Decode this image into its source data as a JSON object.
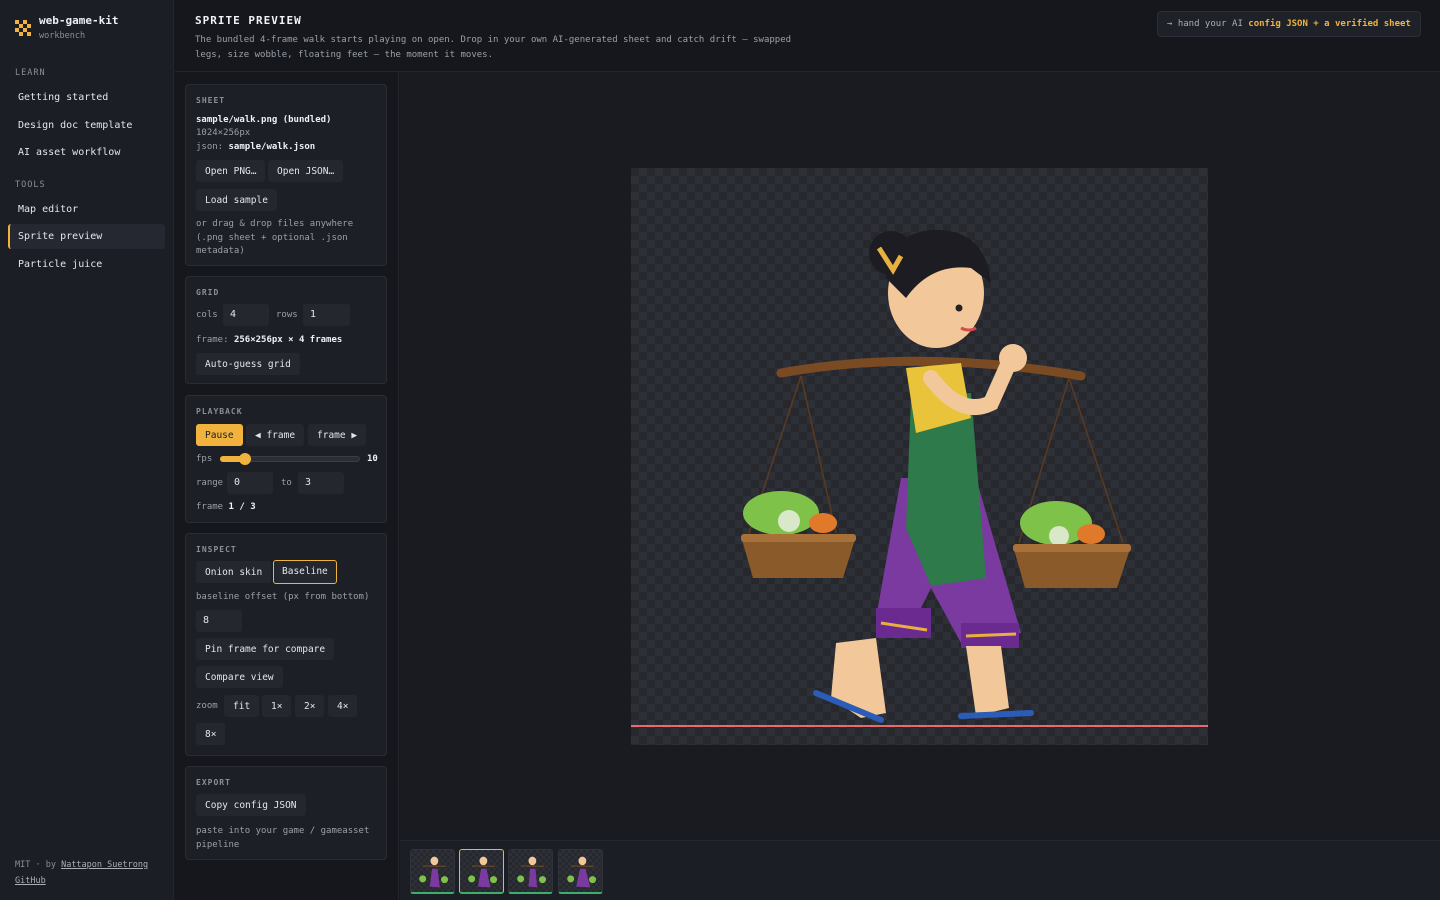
{
  "sidebar": {
    "brand": {
      "title": "web-game-kit",
      "subtitle": "workbench"
    },
    "sections": [
      {
        "label": "LEARN",
        "items": [
          "Getting started",
          "Design doc template",
          "AI asset workflow"
        ]
      },
      {
        "label": "TOOLS",
        "items": [
          "Map editor",
          "Sprite preview",
          "Particle juice"
        ]
      }
    ],
    "active_item": "Sprite preview",
    "footer": {
      "license": "MIT · by",
      "author": "Nattapon Suetrong",
      "github": "GitHub"
    }
  },
  "header": {
    "title": "SPRITE PREVIEW",
    "description": "The bundled 4-frame walk starts playing on open. Drop in your own AI-generated sheet and catch drift — swapped legs, size wobble, floating feet — the moment it moves.",
    "hint_prefix": "→ hand your AI",
    "hint_strong": "config JSON + a verified sheet"
  },
  "sheet": {
    "title": "SHEET",
    "file": "sample/walk.png (bundled)",
    "size": "1024×256px",
    "json_label": "json:",
    "json_file": "sample/walk.json",
    "open_png": "Open PNG…",
    "open_json": "Open JSON…",
    "load_sample": "Load sample",
    "drop_hint": "or drag & drop files anywhere (.png sheet + optional .json metadata)"
  },
  "grid": {
    "title": "GRID",
    "cols_label": "cols",
    "cols": "4",
    "rows_label": "rows",
    "rows": "1",
    "frame_label": "frame:",
    "frame_value": "256×256px × 4 frames",
    "auto_guess": "Auto-guess grid"
  },
  "playback": {
    "title": "PLAYBACK",
    "pause": "Pause",
    "prev_frame": "◀ frame",
    "next_frame": "frame ▶",
    "fps_label": "fps",
    "fps": "10",
    "fps_fraction": 0.18,
    "range_label": "range",
    "range_from": "0",
    "to_label": "to",
    "range_to": "3",
    "frame_label": "frame",
    "frame_value": "1 / 3"
  },
  "inspect": {
    "title": "INSPECT",
    "onion_skin": "Onion skin",
    "baseline": "Baseline",
    "offset_label": "baseline offset (px from bottom)",
    "offset": "8",
    "pin_frame": "Pin frame for compare",
    "compare_view": "Compare view",
    "zoom_label": "zoom",
    "zoom_options": [
      "fit",
      "1×",
      "2×",
      "4×",
      "8×"
    ]
  },
  "export": {
    "title": "EXPORT",
    "copy_config": "Copy config JSON",
    "hint": "paste into your game / gameasset pipeline"
  },
  "frames": {
    "count": 4,
    "active_index": 1
  },
  "colors": {
    "accent": "#f1b33d",
    "background": "#15171c",
    "baseline": "#ea6a6a",
    "frame_ok": "#3fae6b"
  }
}
